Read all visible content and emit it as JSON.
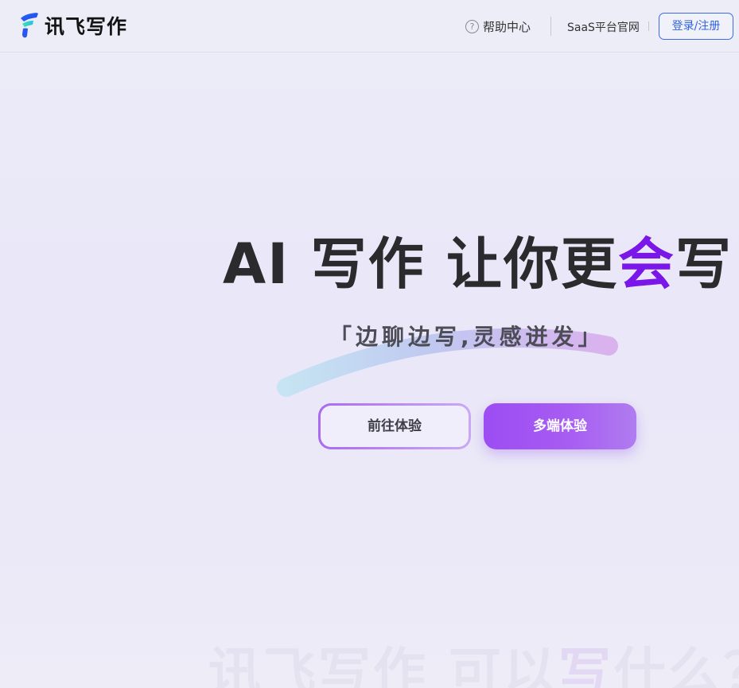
{
  "header": {
    "logo_text": "讯飞写作",
    "help_icon_glyph": "?",
    "help_label": "帮助中心",
    "saas_link": "SaaS平台官网",
    "login_button": "登录/注册"
  },
  "hero": {
    "title_main": "AI 写作 让你更",
    "title_accent": "会",
    "title_end": "写",
    "subtitle": "「边聊边写,灵感迸发」",
    "primary_button": "前往体验",
    "secondary_button": "多端体验"
  },
  "ghost_text": {
    "part1": "讯飞写作 可以",
    "part2": "写",
    "part3": "什么？"
  },
  "colors": {
    "accent_purple": "#7a17e8",
    "login_blue": "#2f63e0",
    "button_gradient_start": "#9c4df3",
    "button_gradient_end": "#b07cf0"
  }
}
